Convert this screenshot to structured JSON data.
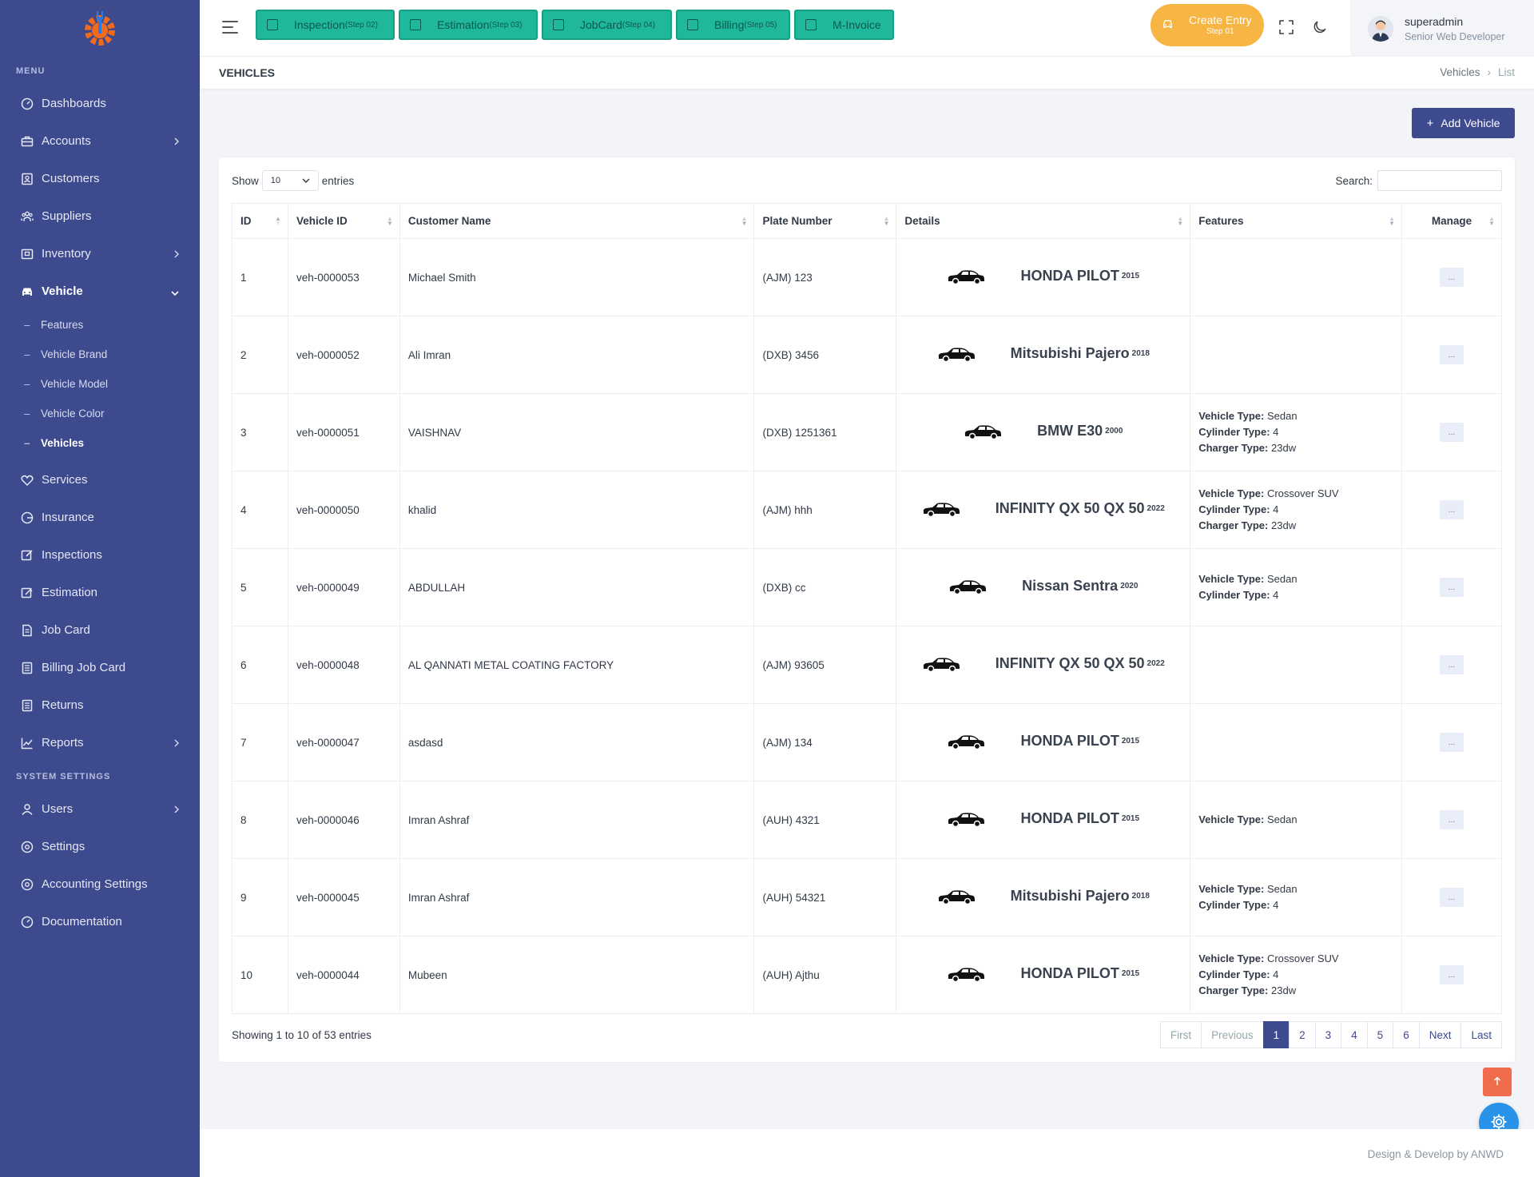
{
  "sidebar": {
    "menu_title": "MENU",
    "system_title": "SYSTEM SETTINGS",
    "items": [
      {
        "label": "Dashboards"
      },
      {
        "label": "Accounts"
      },
      {
        "label": "Customers"
      },
      {
        "label": "Suppliers"
      },
      {
        "label": "Inventory"
      },
      {
        "label": "Vehicle"
      },
      {
        "label": "Services"
      },
      {
        "label": "Insurance"
      },
      {
        "label": "Inspections"
      },
      {
        "label": "Estimation"
      },
      {
        "label": "Job Card"
      },
      {
        "label": "Billing Job Card"
      },
      {
        "label": "Returns"
      },
      {
        "label": "Reports"
      }
    ],
    "vehicle_sub": [
      {
        "label": "Features"
      },
      {
        "label": "Vehicle Brand"
      },
      {
        "label": "Vehicle Model"
      },
      {
        "label": "Vehicle Color"
      },
      {
        "label": "Vehicles"
      }
    ],
    "system_items": [
      {
        "label": "Users"
      },
      {
        "label": "Settings"
      },
      {
        "label": "Accounting Settings"
      },
      {
        "label": "Documentation"
      }
    ]
  },
  "topbar": {
    "steps": [
      {
        "label": "Inspection",
        "step": "(Step 02)"
      },
      {
        "label": "Estimation",
        "step": "(Step 03)"
      },
      {
        "label": "JobCard",
        "step": "(Step 04)"
      },
      {
        "label": "Billing",
        "step": "(Step 05)"
      },
      {
        "label": "M-Invoice",
        "step": ""
      }
    ],
    "create_entry": {
      "label": "Create Entry",
      "step": "Step 01"
    },
    "user": {
      "name": "superadmin",
      "role": "Senior Web Developer"
    }
  },
  "page": {
    "title": "VEHICLES",
    "breadcrumb": [
      "Vehicles",
      "List"
    ],
    "add_button": "Add Vehicle"
  },
  "table": {
    "show_label": "Show",
    "entries_label": "entries",
    "page_size": "10",
    "search_label": "Search:",
    "search_value": "",
    "columns": [
      "ID",
      "Vehicle ID",
      "Customer Name",
      "Plate Number",
      "Details",
      "Features",
      "Manage"
    ],
    "rows": [
      {
        "id": "1",
        "vehicle_id": "veh-0000053",
        "customer": "Michael Smith",
        "plate": "(AJM) 123",
        "name": "HONDA PILOT",
        "year": "2015",
        "features": []
      },
      {
        "id": "2",
        "vehicle_id": "veh-0000052",
        "customer": "Ali Imran",
        "plate": "(DXB) 3456",
        "name": "Mitsubishi Pajero",
        "year": "2018",
        "features": []
      },
      {
        "id": "3",
        "vehicle_id": "veh-0000051",
        "customer": "VAISHNAV",
        "plate": "(DXB) 1251361",
        "name": "BMW E30",
        "year": "2000",
        "features": [
          {
            "k": "Vehicle Type:",
            "v": "Sedan"
          },
          {
            "k": "Cylinder Type:",
            "v": "4"
          },
          {
            "k": "Charger Type:",
            "v": "23dw"
          }
        ]
      },
      {
        "id": "4",
        "vehicle_id": "veh-0000050",
        "customer": "khalid",
        "plate": "(AJM) hhh",
        "name": "INFINITY QX 50 QX 50",
        "year": "2022",
        "features": [
          {
            "k": "Vehicle Type:",
            "v": "Crossover SUV"
          },
          {
            "k": "Cylinder Type:",
            "v": "4"
          },
          {
            "k": "Charger Type:",
            "v": "23dw"
          }
        ]
      },
      {
        "id": "5",
        "vehicle_id": "veh-0000049",
        "customer": "ABDULLAH",
        "plate": "(DXB) cc",
        "name": "Nissan Sentra",
        "year": "2020",
        "features": [
          {
            "k": "Vehicle Type:",
            "v": "Sedan"
          },
          {
            "k": "Cylinder Type:",
            "v": "4"
          }
        ]
      },
      {
        "id": "6",
        "vehicle_id": "veh-0000048",
        "customer": "AL QANNATI METAL COATING FACTORY",
        "plate": "(AJM) 93605",
        "name": "INFINITY QX 50 QX 50",
        "year": "2022",
        "features": []
      },
      {
        "id": "7",
        "vehicle_id": "veh-0000047",
        "customer": "asdasd",
        "plate": "(AJM) 134",
        "name": "HONDA PILOT",
        "year": "2015",
        "features": []
      },
      {
        "id": "8",
        "vehicle_id": "veh-0000046",
        "customer": "Imran Ashraf",
        "plate": "(AUH) 4321",
        "name": "HONDA PILOT",
        "year": "2015",
        "features": [
          {
            "k": "Vehicle Type:",
            "v": "Sedan"
          }
        ]
      },
      {
        "id": "9",
        "vehicle_id": "veh-0000045",
        "customer": "Imran Ashraf",
        "plate": "(AUH) 54321",
        "name": "Mitsubishi Pajero",
        "year": "2018",
        "features": [
          {
            "k": "Vehicle Type:",
            "v": "Sedan"
          },
          {
            "k": "Cylinder Type:",
            "v": "4"
          }
        ]
      },
      {
        "id": "10",
        "vehicle_id": "veh-0000044",
        "customer": "Mubeen",
        "plate": "(AUH) Ajthu",
        "name": "HONDA PILOT",
        "year": "2015",
        "features": [
          {
            "k": "Vehicle Type:",
            "v": "Crossover SUV"
          },
          {
            "k": "Cylinder Type:",
            "v": "4"
          },
          {
            "k": "Charger Type:",
            "v": "23dw"
          }
        ]
      }
    ],
    "manage_label": "...",
    "info": "Showing 1 to 10 of 53 entries",
    "pagination": [
      "First",
      "Previous",
      "1",
      "2",
      "3",
      "4",
      "5",
      "6",
      "Next",
      "Last"
    ],
    "current_page": "1"
  },
  "footer": {
    "text": "Design & Develop by ANWD"
  },
  "colors": {
    "sidebar": "#3e4a8e",
    "step": "#1fb89a",
    "create": "#f7b543",
    "accent": "#3e4a8e",
    "scrolltop": "#f16c4c",
    "fab": "#2893e8"
  }
}
